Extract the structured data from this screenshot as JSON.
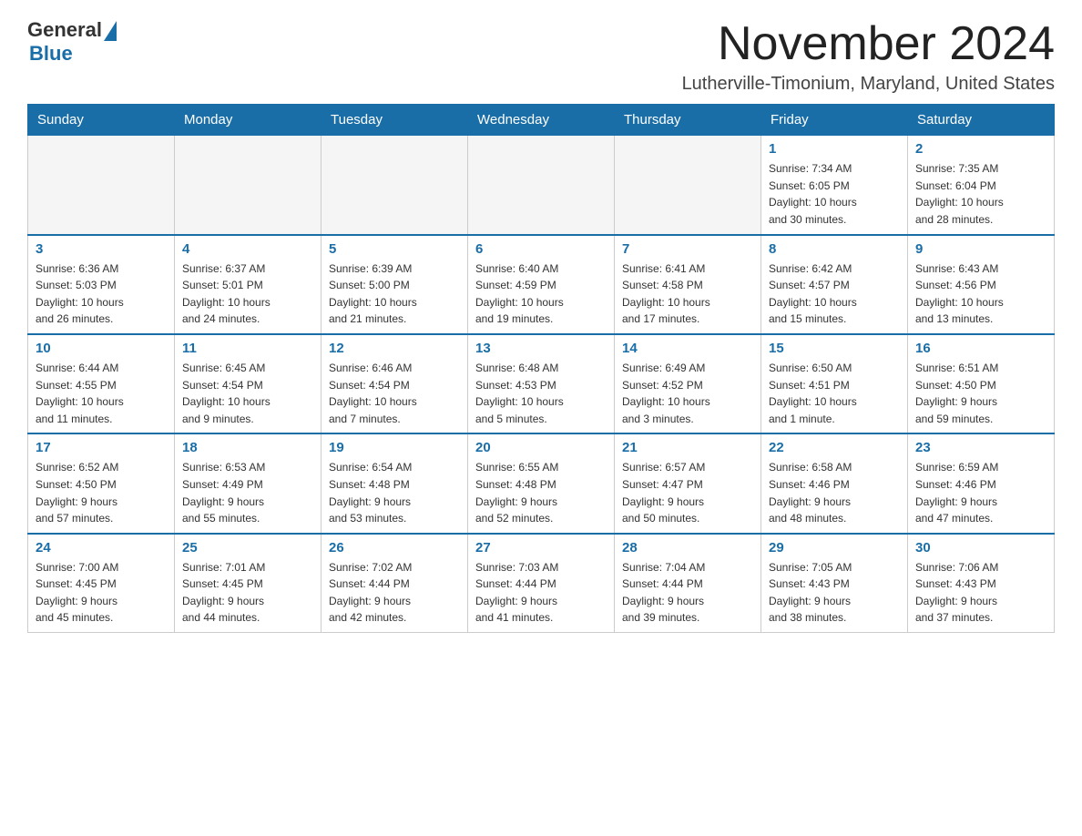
{
  "header": {
    "logo_general": "General",
    "logo_blue": "Blue",
    "month_title": "November 2024",
    "location": "Lutherville-Timonium, Maryland, United States"
  },
  "weekdays": [
    "Sunday",
    "Monday",
    "Tuesday",
    "Wednesday",
    "Thursday",
    "Friday",
    "Saturday"
  ],
  "weeks": [
    [
      {
        "day": "",
        "info": ""
      },
      {
        "day": "",
        "info": ""
      },
      {
        "day": "",
        "info": ""
      },
      {
        "day": "",
        "info": ""
      },
      {
        "day": "",
        "info": ""
      },
      {
        "day": "1",
        "info": "Sunrise: 7:34 AM\nSunset: 6:05 PM\nDaylight: 10 hours\nand 30 minutes."
      },
      {
        "day": "2",
        "info": "Sunrise: 7:35 AM\nSunset: 6:04 PM\nDaylight: 10 hours\nand 28 minutes."
      }
    ],
    [
      {
        "day": "3",
        "info": "Sunrise: 6:36 AM\nSunset: 5:03 PM\nDaylight: 10 hours\nand 26 minutes."
      },
      {
        "day": "4",
        "info": "Sunrise: 6:37 AM\nSunset: 5:01 PM\nDaylight: 10 hours\nand 24 minutes."
      },
      {
        "day": "5",
        "info": "Sunrise: 6:39 AM\nSunset: 5:00 PM\nDaylight: 10 hours\nand 21 minutes."
      },
      {
        "day": "6",
        "info": "Sunrise: 6:40 AM\nSunset: 4:59 PM\nDaylight: 10 hours\nand 19 minutes."
      },
      {
        "day": "7",
        "info": "Sunrise: 6:41 AM\nSunset: 4:58 PM\nDaylight: 10 hours\nand 17 minutes."
      },
      {
        "day": "8",
        "info": "Sunrise: 6:42 AM\nSunset: 4:57 PM\nDaylight: 10 hours\nand 15 minutes."
      },
      {
        "day": "9",
        "info": "Sunrise: 6:43 AM\nSunset: 4:56 PM\nDaylight: 10 hours\nand 13 minutes."
      }
    ],
    [
      {
        "day": "10",
        "info": "Sunrise: 6:44 AM\nSunset: 4:55 PM\nDaylight: 10 hours\nand 11 minutes."
      },
      {
        "day": "11",
        "info": "Sunrise: 6:45 AM\nSunset: 4:54 PM\nDaylight: 10 hours\nand 9 minutes."
      },
      {
        "day": "12",
        "info": "Sunrise: 6:46 AM\nSunset: 4:54 PM\nDaylight: 10 hours\nand 7 minutes."
      },
      {
        "day": "13",
        "info": "Sunrise: 6:48 AM\nSunset: 4:53 PM\nDaylight: 10 hours\nand 5 minutes."
      },
      {
        "day": "14",
        "info": "Sunrise: 6:49 AM\nSunset: 4:52 PM\nDaylight: 10 hours\nand 3 minutes."
      },
      {
        "day": "15",
        "info": "Sunrise: 6:50 AM\nSunset: 4:51 PM\nDaylight: 10 hours\nand 1 minute."
      },
      {
        "day": "16",
        "info": "Sunrise: 6:51 AM\nSunset: 4:50 PM\nDaylight: 9 hours\nand 59 minutes."
      }
    ],
    [
      {
        "day": "17",
        "info": "Sunrise: 6:52 AM\nSunset: 4:50 PM\nDaylight: 9 hours\nand 57 minutes."
      },
      {
        "day": "18",
        "info": "Sunrise: 6:53 AM\nSunset: 4:49 PM\nDaylight: 9 hours\nand 55 minutes."
      },
      {
        "day": "19",
        "info": "Sunrise: 6:54 AM\nSunset: 4:48 PM\nDaylight: 9 hours\nand 53 minutes."
      },
      {
        "day": "20",
        "info": "Sunrise: 6:55 AM\nSunset: 4:48 PM\nDaylight: 9 hours\nand 52 minutes."
      },
      {
        "day": "21",
        "info": "Sunrise: 6:57 AM\nSunset: 4:47 PM\nDaylight: 9 hours\nand 50 minutes."
      },
      {
        "day": "22",
        "info": "Sunrise: 6:58 AM\nSunset: 4:46 PM\nDaylight: 9 hours\nand 48 minutes."
      },
      {
        "day": "23",
        "info": "Sunrise: 6:59 AM\nSunset: 4:46 PM\nDaylight: 9 hours\nand 47 minutes."
      }
    ],
    [
      {
        "day": "24",
        "info": "Sunrise: 7:00 AM\nSunset: 4:45 PM\nDaylight: 9 hours\nand 45 minutes."
      },
      {
        "day": "25",
        "info": "Sunrise: 7:01 AM\nSunset: 4:45 PM\nDaylight: 9 hours\nand 44 minutes."
      },
      {
        "day": "26",
        "info": "Sunrise: 7:02 AM\nSunset: 4:44 PM\nDaylight: 9 hours\nand 42 minutes."
      },
      {
        "day": "27",
        "info": "Sunrise: 7:03 AM\nSunset: 4:44 PM\nDaylight: 9 hours\nand 41 minutes."
      },
      {
        "day": "28",
        "info": "Sunrise: 7:04 AM\nSunset: 4:44 PM\nDaylight: 9 hours\nand 39 minutes."
      },
      {
        "day": "29",
        "info": "Sunrise: 7:05 AM\nSunset: 4:43 PM\nDaylight: 9 hours\nand 38 minutes."
      },
      {
        "day": "30",
        "info": "Sunrise: 7:06 AM\nSunset: 4:43 PM\nDaylight: 9 hours\nand 37 minutes."
      }
    ]
  ]
}
